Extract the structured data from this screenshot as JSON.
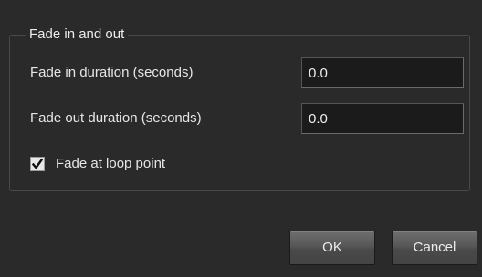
{
  "dialog": {
    "group_title": "Fade in and out",
    "fade_in": {
      "label": "Fade in duration (seconds)",
      "value": "0.0"
    },
    "fade_out": {
      "label": "Fade out duration (seconds)",
      "value": "0.0"
    },
    "loop_fade": {
      "label": "Fade at loop point",
      "checked": true
    },
    "ok_label": "OK",
    "cancel_label": "Cancel"
  },
  "colors": {
    "background": "#2a2a2a",
    "field_background": "#1b1b1b",
    "text": "#e6e6e6"
  },
  "icons": {
    "checkbox": "checkmark-icon"
  }
}
